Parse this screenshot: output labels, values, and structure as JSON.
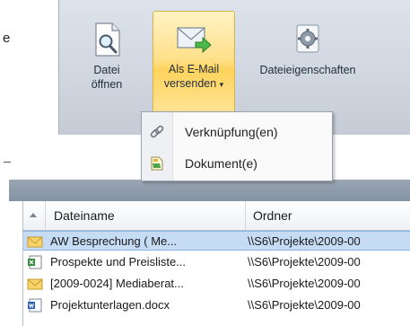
{
  "left_fragment": {
    "text": "e"
  },
  "ribbon": {
    "buttons": [
      {
        "label_line1": "Datei",
        "label_line2": "öffnen",
        "icon": "file-search-icon"
      },
      {
        "label_line1": "Als E-Mail",
        "label_line2": "versenden",
        "caret": "▾",
        "icon": "email-send-icon",
        "state": "hover"
      },
      {
        "label_line1": "Dateieigenschaften",
        "icon": "gear-icon"
      }
    ]
  },
  "menu": {
    "items": [
      {
        "label": "Verknüpfung(en)",
        "icon": "link-icon"
      },
      {
        "label": "Dokument(e)",
        "icon": "document-icon"
      }
    ]
  },
  "grid": {
    "columns": [
      "Dateiname",
      "Ordner"
    ],
    "rows": [
      {
        "name": "AW Besprechung  ( Me...",
        "folder": "\\\\S6\\Projekte\\2009-00",
        "icon": "email-icon",
        "selected": true
      },
      {
        "name": "Prospekte und Preisliste...",
        "folder": "\\\\S6\\Projekte\\2009-00",
        "icon": "spreadsheet-icon",
        "selected": false
      },
      {
        "name": "[2009-0024] Mediaberat...",
        "folder": "\\\\S6\\Projekte\\2009-00",
        "icon": "email-icon",
        "selected": false
      },
      {
        "name": "Projektunterlagen.docx",
        "folder": "\\\\S6\\Projekte\\2009-00",
        "icon": "word-document-icon",
        "selected": false
      }
    ]
  },
  "colors": {
    "ribbon_bg": "#cfd6df",
    "hover_button": "#ffe08a",
    "selected_row": "#c6dcf5",
    "band": "#8e9bab"
  }
}
